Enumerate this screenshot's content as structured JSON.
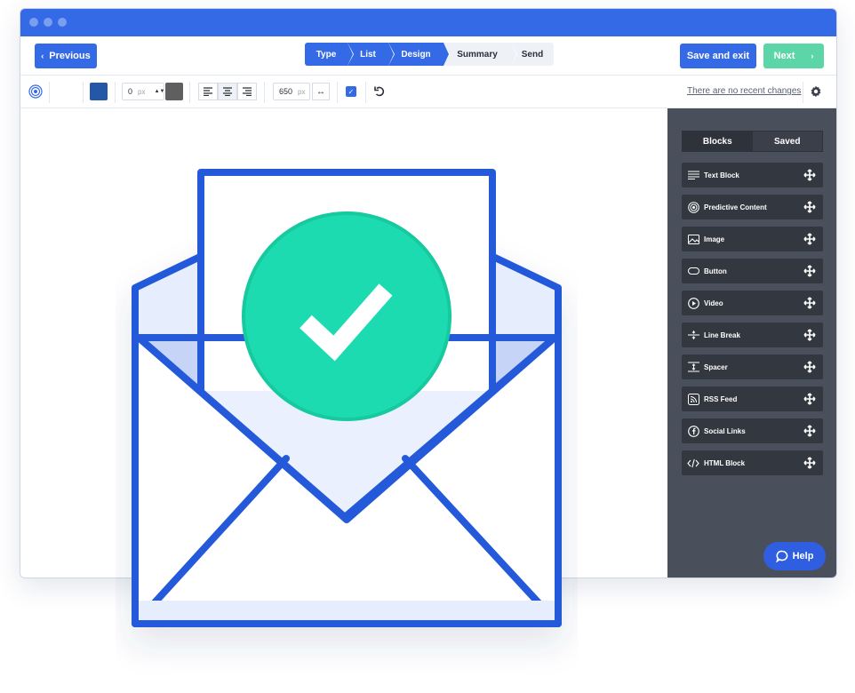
{
  "nav": {
    "previous_label": "Previous",
    "save_label": "Save and exit",
    "next_label": "Next",
    "steps": [
      {
        "label": "Type",
        "state": "done"
      },
      {
        "label": "List",
        "state": "done"
      },
      {
        "label": "Design",
        "state": "done"
      },
      {
        "label": "Summary",
        "state": "todo"
      },
      {
        "label": "Send",
        "state": "todo"
      }
    ]
  },
  "toolbar": {
    "padding_value": "0",
    "padding_unit": "px",
    "width_value": "650",
    "width_unit": "px",
    "recent_changes_text": "There are no recent changes",
    "fill_color": "#2458a6",
    "border_color": "#5f5f5f"
  },
  "panel": {
    "tab_blocks": "Blocks",
    "tab_saved": "Saved",
    "blocks": [
      {
        "label": "Text Block",
        "icon": "text-lines-icon"
      },
      {
        "label": "Predictive Content",
        "icon": "predictive-icon"
      },
      {
        "label": "Image",
        "icon": "image-icon"
      },
      {
        "label": "Button",
        "icon": "button-icon"
      },
      {
        "label": "Video",
        "icon": "play-icon"
      },
      {
        "label": "Line Break",
        "icon": "line-break-icon"
      },
      {
        "label": "Spacer",
        "icon": "spacer-icon"
      },
      {
        "label": "RSS Feed",
        "icon": "rss-icon"
      },
      {
        "label": "Social Links",
        "icon": "facebook-icon"
      },
      {
        "label": "HTML Block",
        "icon": "code-icon"
      }
    ],
    "help_label": "Help"
  },
  "colors": {
    "brand_blue": "#356ae6",
    "next_green": "#5cd5a8",
    "check_green": "#1ddbb0",
    "panel_bg": "#4a4f5c"
  }
}
